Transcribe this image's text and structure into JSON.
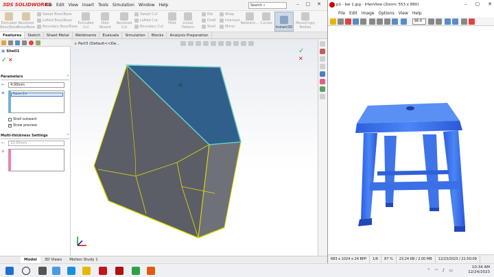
{
  "solidworks": {
    "logo": "SOLIDWORKS",
    "menu": [
      "File",
      "Edit",
      "View",
      "Insert",
      "Tools",
      "Simulation",
      "Window",
      "Help"
    ],
    "search": "Search",
    "ribbon": {
      "extruded_boss": "Extruded Boss/Base",
      "revolved_boss": "Revolved Boss/Base",
      "swept_boss": "Swept Boss/Base",
      "lofted_boss": "Lofted Boss/Base",
      "boundary_boss": "Boundary Boss/Base",
      "extruded_cut": "Extruded Cut",
      "hole_wizard": "Hole Wizard",
      "revolved_cut": "Revolved Cut",
      "swept_cut": "Swept Cut",
      "lofted_cut": "Lofted Cut",
      "boundary_cut": "Boundary Cut",
      "fillet": "Fillet",
      "linear_pattern": "Linear Pattern",
      "rib": "Rib",
      "draft": "Draft",
      "shell": "Shell",
      "wrap": "Wrap",
      "intersect": "Intersect",
      "mirror": "Mirror",
      "reference": "Referenc...",
      "curves": "Curves",
      "instant3d": "Instant3D",
      "move_copy": "Move/Copy Bodies"
    },
    "tabs": [
      "Features",
      "Sketch",
      "Sheet Metal",
      "Weldments",
      "Evaluate",
      "Simulation",
      "Blocks",
      "Analysis Preparation"
    ],
    "breadcrumb": "Part3 (Default<<De...",
    "property_manager": {
      "title": "Shell1",
      "parameters_label": "Parameters",
      "thickness": "4.00mm",
      "face": "Face<1>",
      "shell_outward": "Shell outward",
      "show_preview": "Show preview",
      "multi_label": "Multi-thickness Settings",
      "multi_thickness": "10.00mm"
    },
    "bottom_tabs": [
      "Model",
      "3D Views",
      "Motion Study 1"
    ]
  },
  "irfanview": {
    "title": "p1 - bw 1.jpg - IrfanView (Zoom: 553 x 880)",
    "menu": [
      "File",
      "Edit",
      "Image",
      "Options",
      "View",
      "Help"
    ],
    "zoom": "86.6",
    "status": [
      "683 x 1024 x 24 BPP",
      "1/6",
      "87 %",
      "23.24 KB / 2.00 MB",
      "12/23/2023 / 21:50:09"
    ]
  },
  "taskbar": {
    "time": "10:34 AM",
    "date": "12/24/2023"
  },
  "colors": {
    "accent": "#4a7fc1",
    "stool": "#3a6fe6",
    "box_top": "#2f5f8a",
    "edge_highlight": "#e3e200"
  }
}
